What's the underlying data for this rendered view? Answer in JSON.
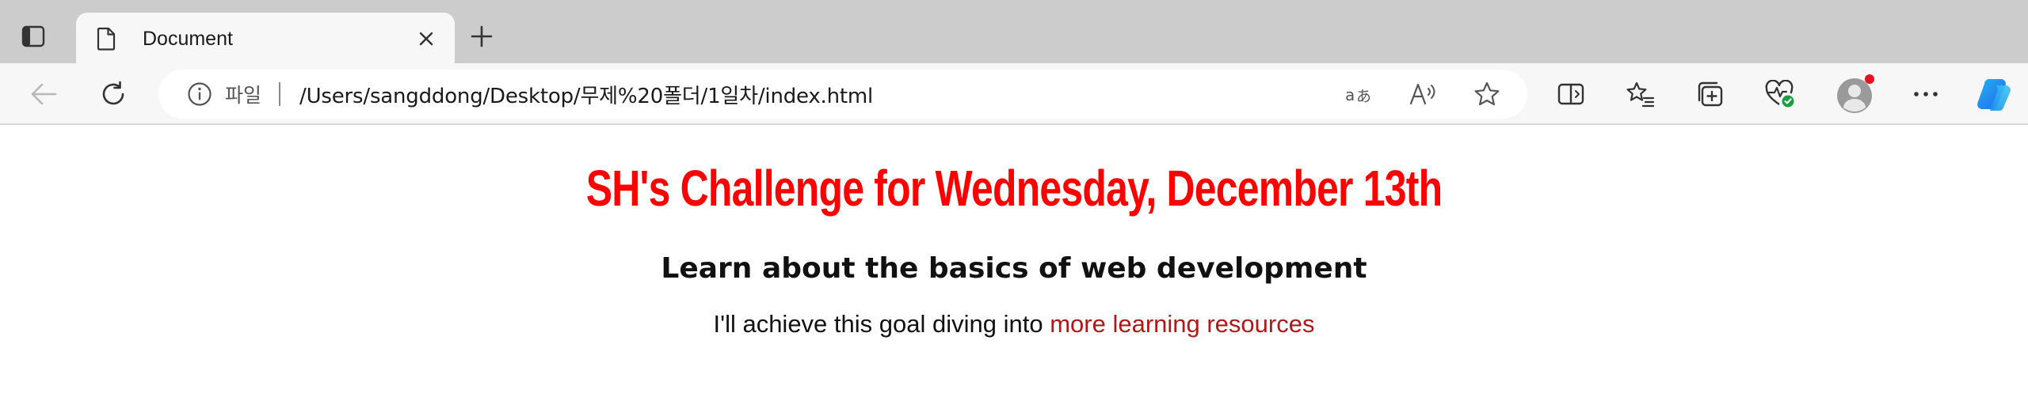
{
  "browser": {
    "tab": {
      "title": "Document"
    },
    "address": {
      "site_label": "파일",
      "url": "/Users/sangddong/Desktop/무제%20폴더/1일차/index.html"
    },
    "colors": {
      "tabstrip_bg": "#cccccc",
      "toolbar_bg": "#f7f7f7",
      "profile_badge": "#e81123",
      "copilot_gradient": [
        "#1fb5f5",
        "#2764e7"
      ]
    },
    "icons": {
      "tab_actions": "tab-actions-icon",
      "tab_favicon": "document-icon",
      "tab_close": "close-icon",
      "new_tab": "plus-icon",
      "back": "back-arrow-icon",
      "refresh": "refresh-icon",
      "site_info": "info-icon",
      "translate": "translate-icon",
      "read_aloud": "read-aloud-icon",
      "favorite": "star-icon",
      "split_screen": "split-screen-icon",
      "favorites": "favorites-icon",
      "collections": "collections-icon",
      "browser_essentials": "heart-pulse-icon",
      "profile": "profile-avatar-icon",
      "more": "more-icon",
      "copilot": "copilot-icon"
    }
  },
  "page": {
    "heading": "SH's Challenge for Wednesday, December 13th",
    "subheading": "Learn about the basics of web development",
    "text_prefix": "I'll achieve this goal diving into ",
    "link_text": "more learning resources",
    "colors": {
      "heading": "#ff0000",
      "link": "#b01818"
    }
  }
}
